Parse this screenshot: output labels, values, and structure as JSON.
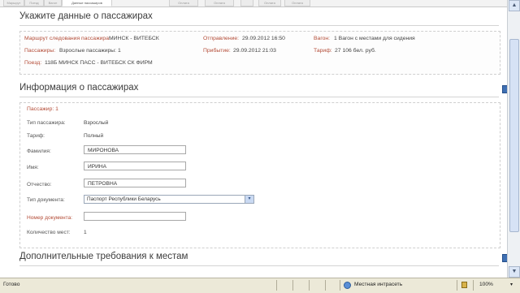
{
  "tabs": [
    "Маршрут",
    "Поезд",
    "Вагон",
    "Данные пассажиров",
    "Оплата",
    "Оплата",
    "",
    "Оплата",
    "Оплата"
  ],
  "headings": {
    "passenger_data": "Укажите данные о пассажирах",
    "passenger_info": "Информация о пассажирах",
    "additional": "Дополнительные требования к местам"
  },
  "summary": {
    "route_label": "Маршрут следования пассажира:",
    "route_value": "МИНСК - ВИТЕБСК",
    "departure_label": "Отправление:",
    "departure_value": "29.09.2012 16:50",
    "car_label": "Вагон:",
    "car_value": "1 Вагон с местами для сидения",
    "passengers_label": "Пассажиры:",
    "passengers_value": "Взрослые пассажиры: 1",
    "arrival_label": "Прибытие:",
    "arrival_value": "29.09.2012 21:03",
    "fare_label": "Тариф:",
    "fare_value": "27 106 бел. руб.",
    "train_label": "Поезд:",
    "train_value": "118Б МИНСК ПАСС - ВИТЕБСК СК ФИРМ"
  },
  "passenger": {
    "title": "Пассажир: 1",
    "type_label": "Тип пассажира:",
    "type_value": "Взрослый",
    "tariff_label": "Тариф:",
    "tariff_value": "Полный",
    "surname_label": "Фамилия:",
    "surname_value": "МИРОНОВА",
    "name_label": "Имя:",
    "name_value": "ИРИНА",
    "patronymic_label": "Отчество:",
    "patronymic_value": "ПЕТРОВНА",
    "doc_type_label": "Тип документа:",
    "doc_type_value": "Паспорт Республики Беларусь",
    "doc_number_label": "Номер документа:",
    "doc_number_value": "",
    "seats_label": "Количество мест:",
    "seats_value": "1"
  },
  "statusbar": {
    "left": "Готово",
    "zone": "Местная интрасеть",
    "zoom": "100%"
  },
  "colors": {
    "label_red": "#b34b36",
    "statusbar_bg": "#ece9d8",
    "accent_blue": "#3e6fb3"
  }
}
